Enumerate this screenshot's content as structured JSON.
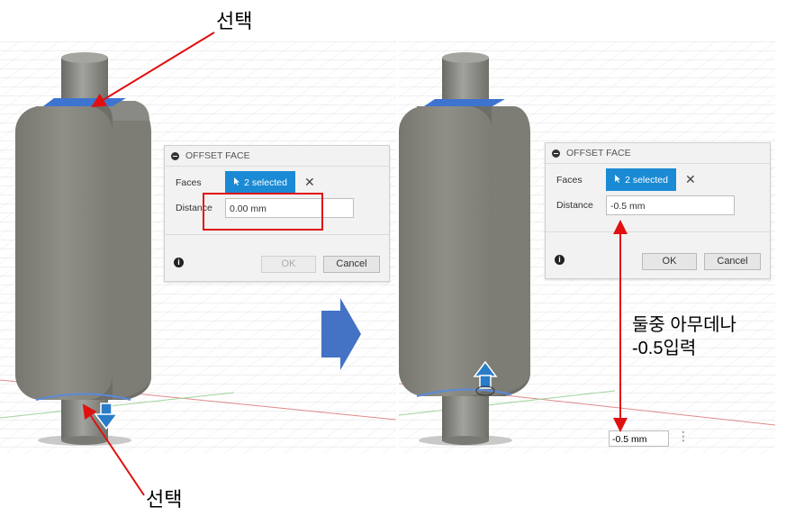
{
  "annotations": {
    "top_label": "선택",
    "bottom_label": "선택",
    "right_note_line1": "둘중 아무데나",
    "right_note_line2": "-0.5입력"
  },
  "left_dialog": {
    "title": "OFFSET FACE",
    "faces_label": "Faces",
    "faces_button": "2 selected",
    "distance_label": "Distance",
    "distance_value": "0.00 mm",
    "ok_label": "OK",
    "cancel_label": "Cancel",
    "ok_enabled": false
  },
  "right_dialog": {
    "title": "OFFSET FACE",
    "faces_label": "Faces",
    "faces_button": "2 selected",
    "distance_label": "Distance",
    "distance_value": "-0.5 mm",
    "ok_label": "OK",
    "cancel_label": "Cancel",
    "ok_enabled": true
  },
  "viewport_input": {
    "value": "-0.5 mm"
  },
  "colors": {
    "highlight_red": "#e01010",
    "selection_blue": "#1a8ad4",
    "body_gray": "#8a8a84",
    "arrow_blue": "#4472c4"
  },
  "icons": [
    "minus-circle-icon",
    "cursor-icon",
    "close-icon",
    "info-icon",
    "down-arrow-manipulator-icon",
    "up-arrow-manipulator-icon",
    "transition-arrow-icon",
    "more-vert-icon"
  ]
}
